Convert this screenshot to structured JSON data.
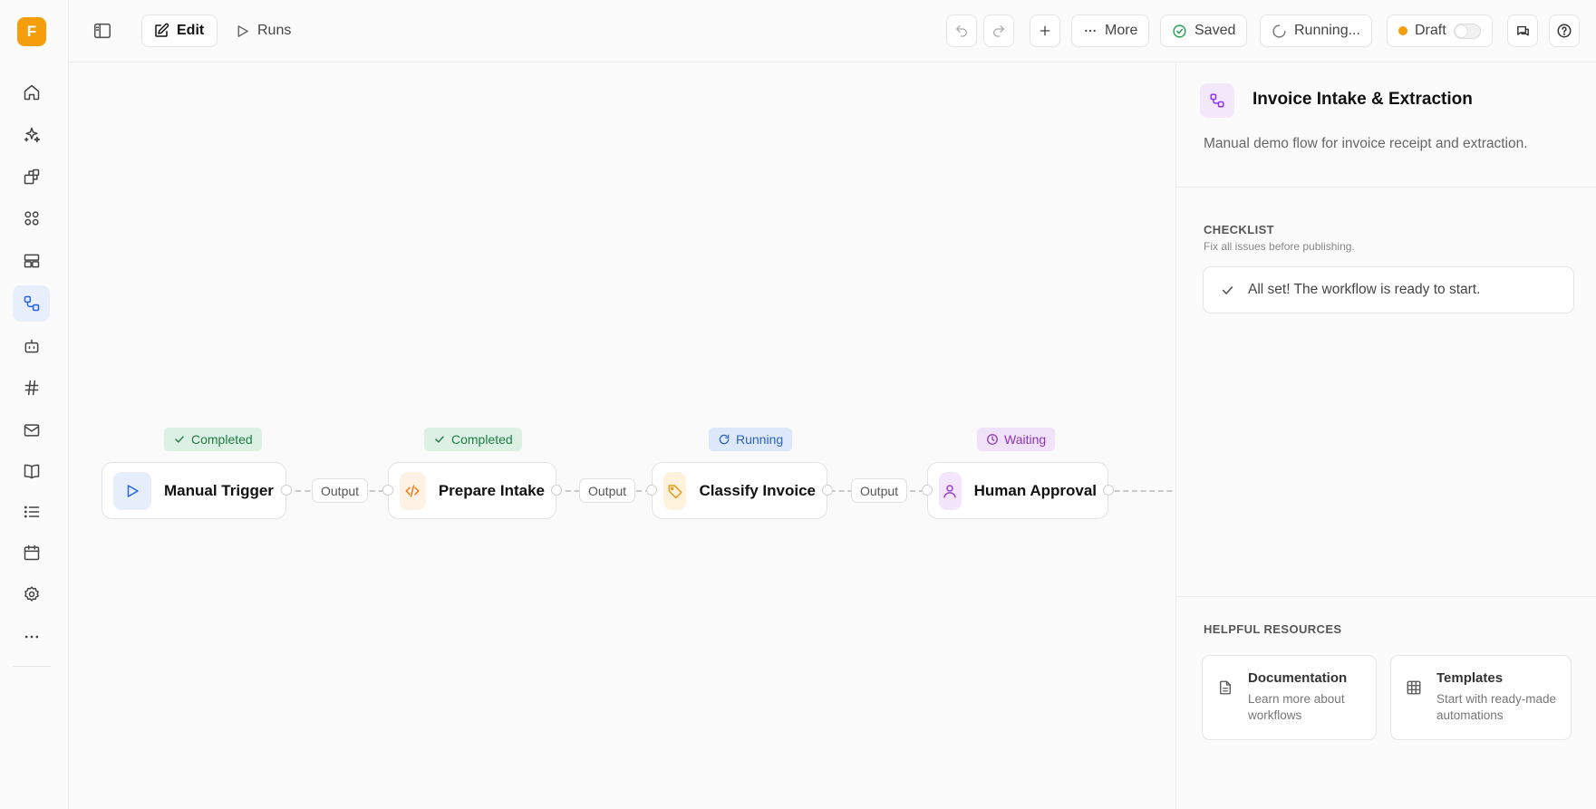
{
  "app": {
    "logo_letter": "F"
  },
  "sidebar": {
    "items": [
      {
        "icon": "home-icon"
      },
      {
        "icon": "sparkles-icon"
      },
      {
        "icon": "blocks-icon"
      },
      {
        "icon": "apps-icon"
      },
      {
        "icon": "layout-icon"
      },
      {
        "icon": "workflow-icon",
        "active": true
      },
      {
        "icon": "bot-icon"
      },
      {
        "icon": "hash-icon"
      },
      {
        "icon": "mail-icon"
      },
      {
        "icon": "book-icon"
      },
      {
        "icon": "list-icon"
      },
      {
        "icon": "calendar-icon"
      },
      {
        "icon": "settings-icon"
      },
      {
        "icon": "more-horizontal-icon"
      }
    ]
  },
  "toolbar": {
    "edit_label": "Edit",
    "runs_label": "Runs",
    "more_label": "More",
    "saved_label": "Saved",
    "running_label": "Running...",
    "draft_label": "Draft"
  },
  "workflow": {
    "nodes": [
      {
        "name": "Manual Trigger",
        "status": "Completed",
        "icon": "play-icon"
      },
      {
        "name": "Prepare Intake",
        "status": "Completed",
        "icon": "code-icon"
      },
      {
        "name": "Classify Invoice",
        "status": "Running",
        "icon": "tag-icon"
      },
      {
        "name": "Human Approval",
        "status": "Waiting",
        "icon": "user-icon"
      }
    ],
    "connector_label": "Output"
  },
  "panel": {
    "title": "Invoice Intake & Extraction",
    "description": "Manual demo flow for invoice receipt and extraction.",
    "checklist": {
      "heading": "CHECKLIST",
      "subheading": "Fix all issues before publishing.",
      "message": "All set! The workflow is ready to start."
    },
    "resources": {
      "heading": "HELPFUL RESOURCES",
      "items": [
        {
          "title": "Documentation",
          "description": "Learn more about workflows"
        },
        {
          "title": "Templates",
          "description": "Start with ready-made automations"
        }
      ]
    }
  },
  "colors": {
    "accent": "#2563eb",
    "logo": "#f59e0b",
    "completed": "#1f7a45",
    "running": "#2a62c9",
    "waiting": "#8b35b5"
  }
}
